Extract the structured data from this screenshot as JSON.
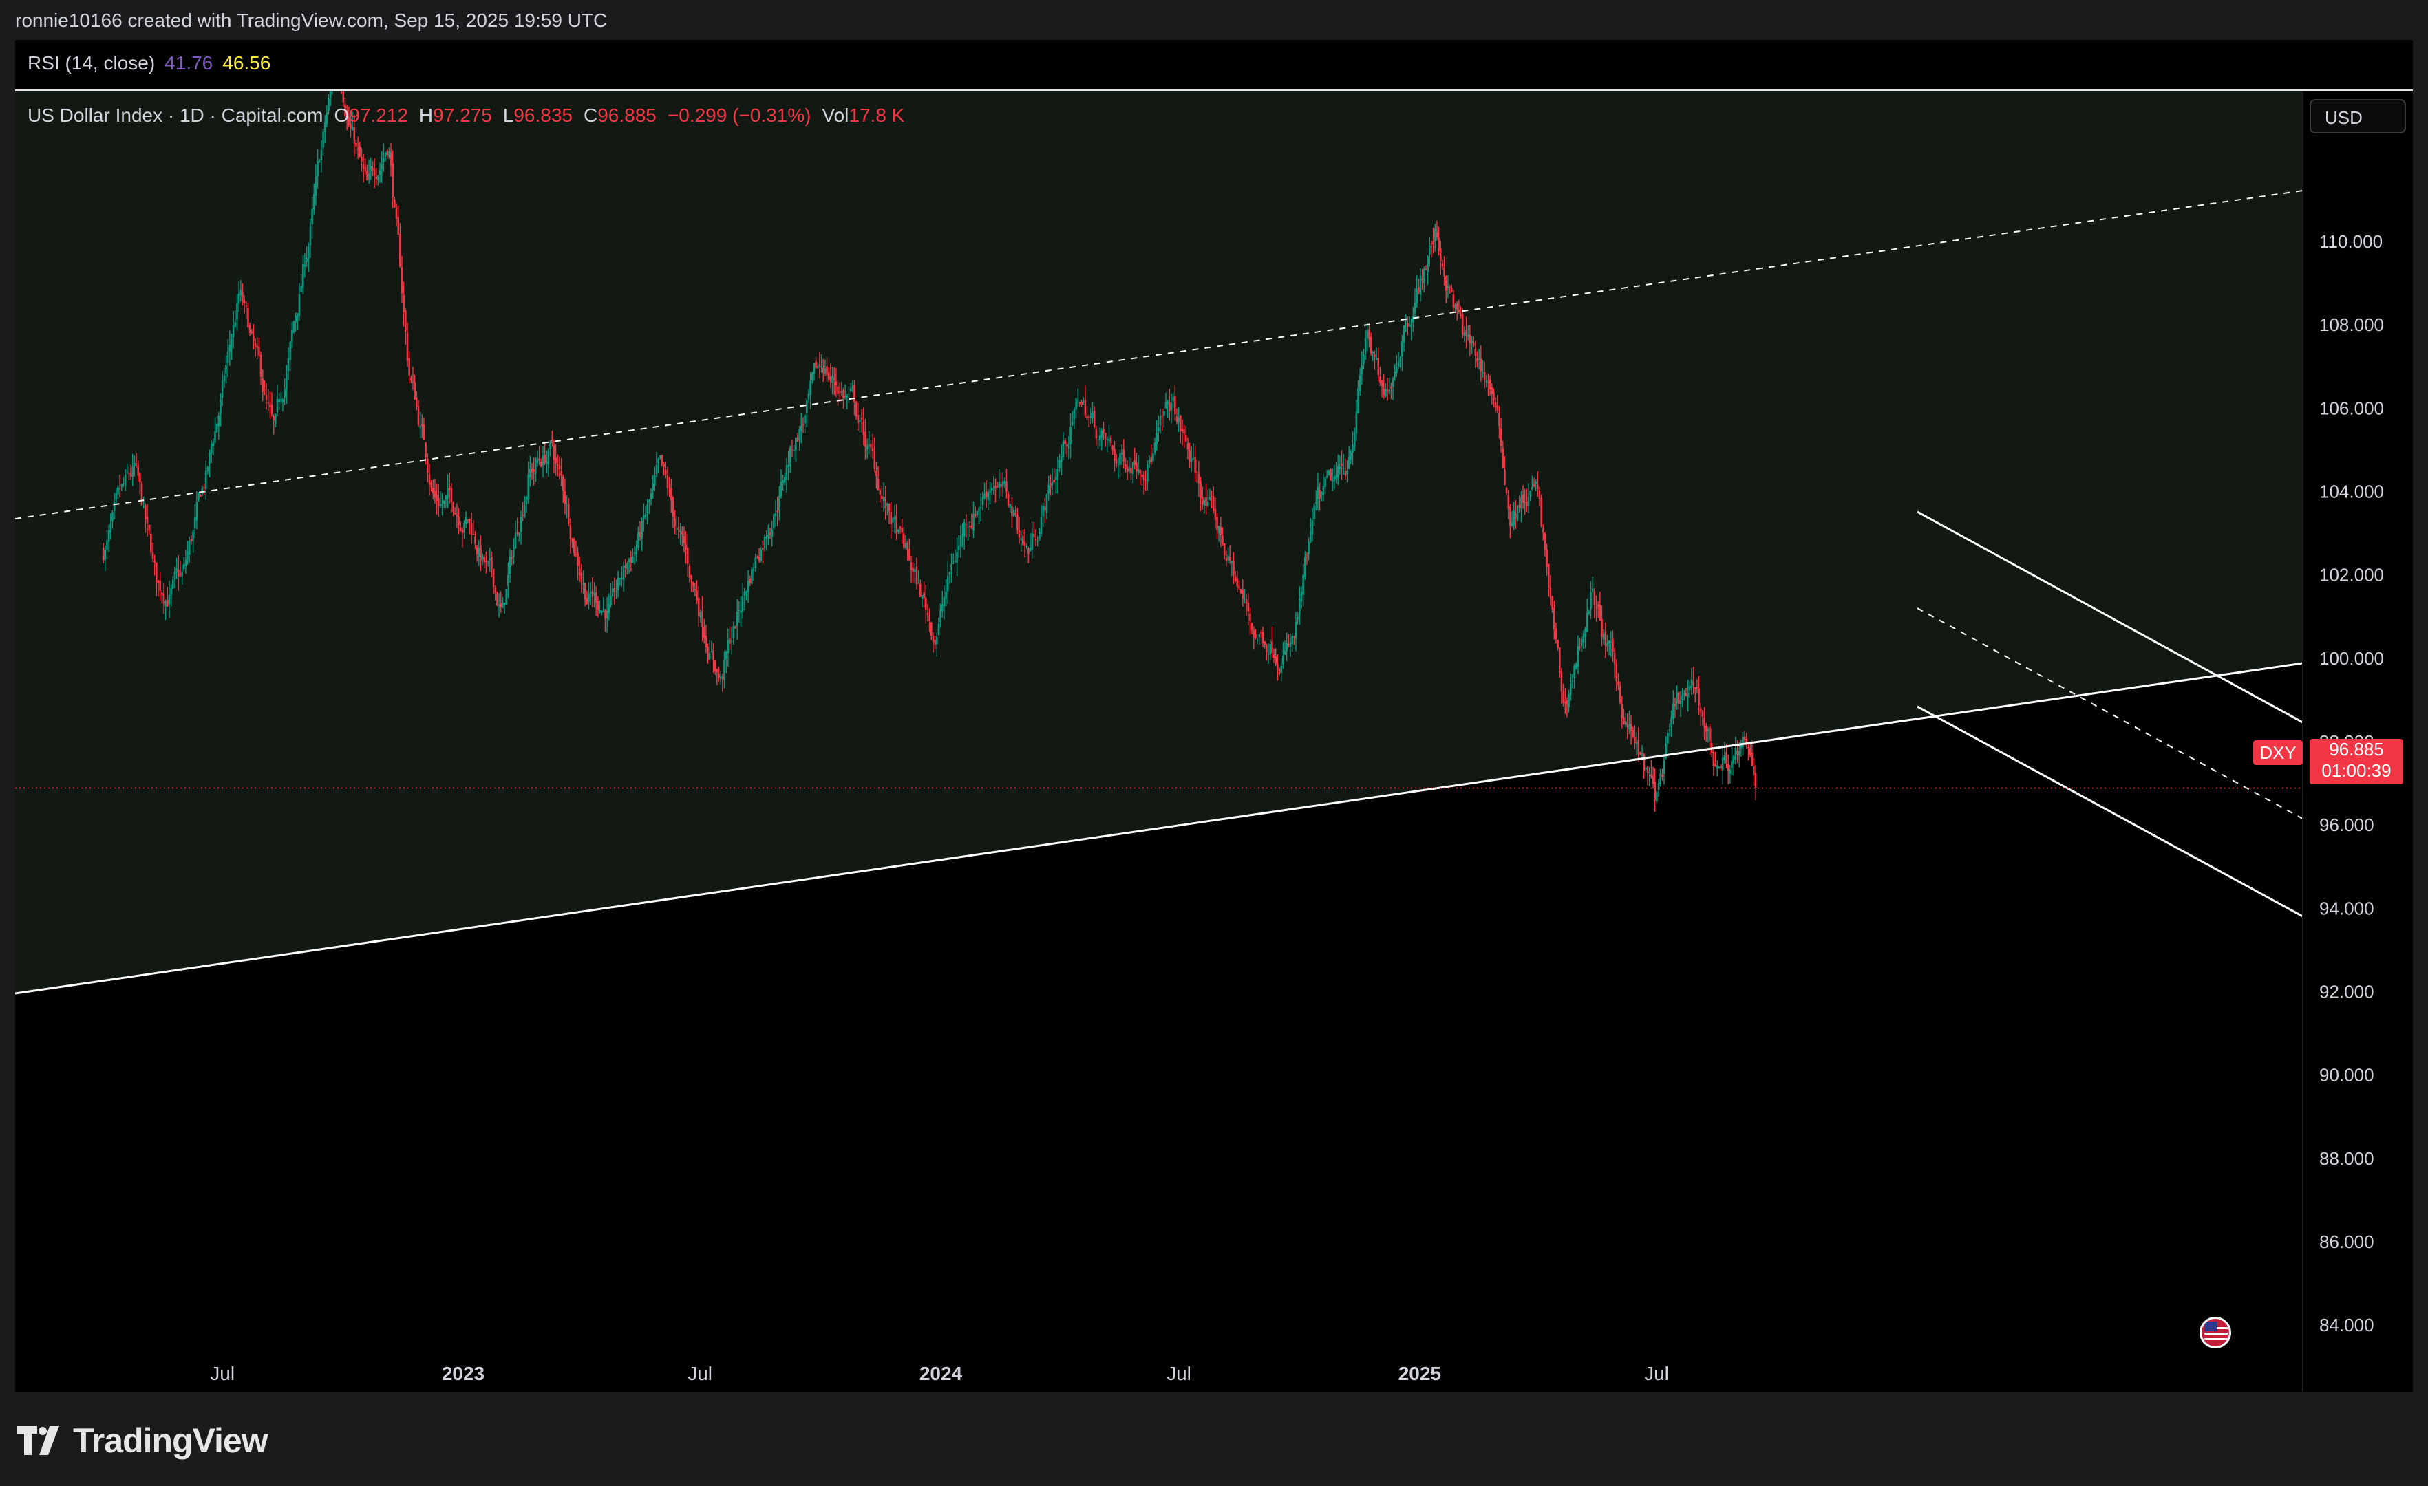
{
  "credit": "ronnie10166 created with TradingView.com, Sep 15, 2025 19:59 UTC",
  "rsi": {
    "label": "RSI (14, close)",
    "value1": "41.76",
    "value2": "46.56"
  },
  "legend": {
    "name": "US Dollar Index · 1D · Capital.com",
    "o_label": "O",
    "o": "97.212",
    "h_label": "H",
    "h": "97.275",
    "l_label": "L",
    "l": "96.835",
    "c_label": "C",
    "c": "96.885",
    "change": "−0.299 (−0.31%)",
    "vol_label": "Vol",
    "vol": "17.8 K"
  },
  "currency": "USD",
  "price_badge": {
    "symbol": "DXY",
    "price": "96.885",
    "countdown": "01:00:39"
  },
  "brand": "TradingView",
  "colors": {
    "up": "#089981",
    "down": "#f23645",
    "bg": "#000000",
    "channel_fill": "#121912",
    "line": "#ffffff"
  },
  "chart_data": {
    "type": "candlestick",
    "symbol": "DXY",
    "ylim": [
      82.4,
      113.6
    ],
    "y_ticks": [
      "110.000",
      "108.000",
      "106.000",
      "104.000",
      "102.000",
      "100.000",
      "98.000",
      "96.000",
      "94.000",
      "92.000",
      "90.000",
      "88.000",
      "86.000",
      "84.000"
    ],
    "x_ticks": [
      {
        "label": "Jul",
        "date": "2022-07-01",
        "bold": false
      },
      {
        "label": "2023",
        "date": "2023-01-01",
        "bold": true
      },
      {
        "label": "Jul",
        "date": "2023-07-01",
        "bold": false
      },
      {
        "label": "2024",
        "date": "2024-01-01",
        "bold": true
      },
      {
        "label": "Jul",
        "date": "2024-07-01",
        "bold": false
      },
      {
        "label": "2025",
        "date": "2025-01-01",
        "bold": true
      },
      {
        "label": "Jul",
        "date": "2025-07-01",
        "bold": false
      }
    ],
    "last_price": 96.885,
    "path": [
      [
        "2022-04-01",
        102.6
      ],
      [
        "2022-04-25",
        104.2
      ],
      [
        "2022-05-12",
        101.5
      ],
      [
        "2022-06-01",
        101.8
      ],
      [
        "2022-06-20",
        104.4
      ],
      [
        "2022-07-14",
        108.6
      ],
      [
        "2022-08-10",
        105.0
      ],
      [
        "2022-08-30",
        108.8
      ],
      [
        "2022-09-27",
        114.5
      ],
      [
        "2022-10-20",
        111.0
      ],
      [
        "2022-11-05",
        112.6
      ],
      [
        "2022-11-20",
        107.0
      ],
      [
        "2022-12-10",
        104.0
      ],
      [
        "2023-01-05",
        103.5
      ],
      [
        "2023-01-31",
        101.0
      ],
      [
        "2023-02-20",
        104.6
      ],
      [
        "2023-03-10",
        105.0
      ],
      [
        "2023-04-05",
        101.8
      ],
      [
        "2023-04-25",
        101.2
      ],
      [
        "2023-05-31",
        104.2
      ],
      [
        "2023-06-20",
        102.2
      ],
      [
        "2023-07-17",
        99.6
      ],
      [
        "2023-08-10",
        102.2
      ],
      [
        "2023-09-10",
        105.2
      ],
      [
        "2023-10-03",
        106.9
      ],
      [
        "2023-10-25",
        106.2
      ],
      [
        "2023-11-20",
        103.6
      ],
      [
        "2023-12-27",
        100.6
      ],
      [
        "2024-01-20",
        103.3
      ],
      [
        "2024-02-10",
        104.5
      ],
      [
        "2024-03-08",
        102.6
      ],
      [
        "2024-04-16",
        106.2
      ],
      [
        "2024-05-15",
        104.6
      ],
      [
        "2024-06-10",
        105.2
      ],
      [
        "2024-06-26",
        105.9
      ],
      [
        "2024-07-15",
        104.2
      ],
      [
        "2024-08-05",
        102.6
      ],
      [
        "2024-08-27",
        100.6
      ],
      [
        "2024-09-27",
        100.4
      ],
      [
        "2024-10-15",
        103.5
      ],
      [
        "2024-11-05",
        104.2
      ],
      [
        "2024-11-22",
        107.9
      ],
      [
        "2024-12-05",
        105.8
      ],
      [
        "2024-12-20",
        108.2
      ],
      [
        "2025-01-13",
        110.2
      ],
      [
        "2025-02-05",
        107.5
      ],
      [
        "2025-02-25",
        106.5
      ],
      [
        "2025-03-11",
        103.5
      ],
      [
        "2025-03-31",
        104.1
      ],
      [
        "2025-04-21",
        98.6
      ],
      [
        "2025-05-12",
        101.6
      ],
      [
        "2025-06-05",
        98.8
      ],
      [
        "2025-06-30",
        96.5
      ],
      [
        "2025-07-17",
        98.7
      ],
      [
        "2025-08-01",
        98.9
      ],
      [
        "2025-08-15",
        97.5
      ],
      [
        "2025-09-05",
        97.7
      ],
      [
        "2025-09-15",
        96.885
      ]
    ]
  }
}
